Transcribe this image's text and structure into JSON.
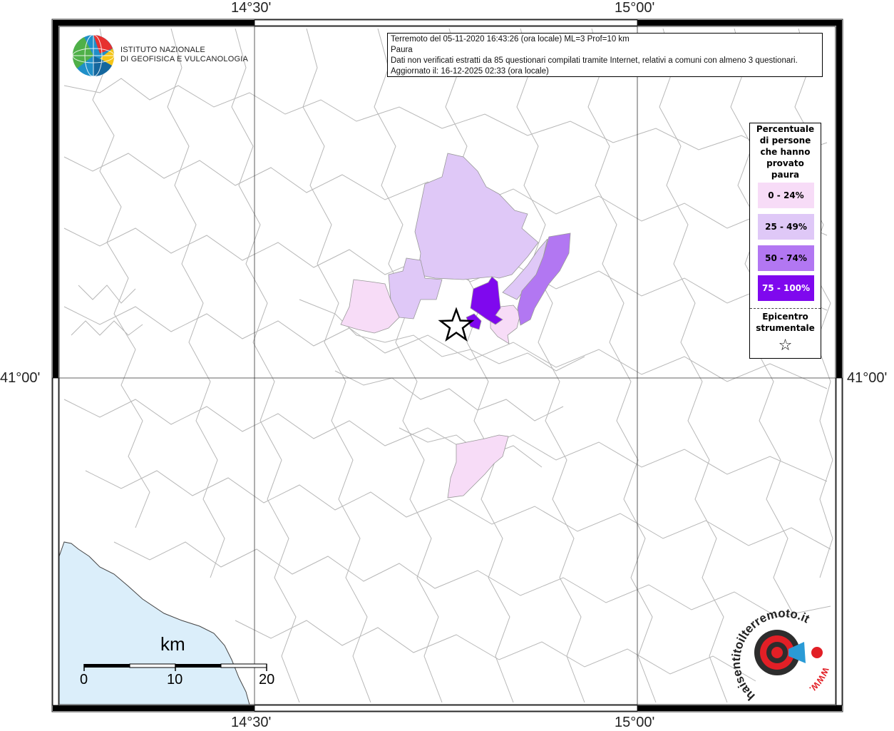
{
  "map": {
    "lon_labels": [
      "14°30'",
      "15°00'"
    ],
    "lat_labels": [
      "41°00'"
    ]
  },
  "info": {
    "line1": "Terremoto del 05-11-2020 16:43:26 (ora locale) ML=3 Prof=10 km",
    "line2": "Paura",
    "line3": "Dati non verificati estratti da 85 questionari compilati tramite Internet, relativi a comuni con almeno 3 questionari.",
    "line4": "Aggiornato il: 16-12-2025 02:33 (ora locale)"
  },
  "logo_ingv": {
    "line1": "ISTITUTO NAZIONALE",
    "line2": "DI GEOFISICA E VULCANOLOGIA"
  },
  "legend": {
    "title_lines": [
      "Percentuale",
      "di persone",
      "che hanno",
      "provato",
      "paura"
    ],
    "classes": [
      {
        "label": "0 - 24%",
        "color": "#f7dcf7"
      },
      {
        "label": "25 - 49%",
        "color": "#dfc8f7"
      },
      {
        "label": "50 - 74%",
        "color": "#b277f2"
      },
      {
        "label": "75 - 100%",
        "color": "#7f08ee"
      }
    ],
    "epicentro_lines": [
      "Epicentro",
      "strumentale"
    ]
  },
  "scale": {
    "unit": "km",
    "labels": [
      "0",
      "10",
      "20"
    ]
  },
  "logo_hsit": {
    "text": "haisentitoilterremoto.it",
    "url_text": "WWW."
  }
}
